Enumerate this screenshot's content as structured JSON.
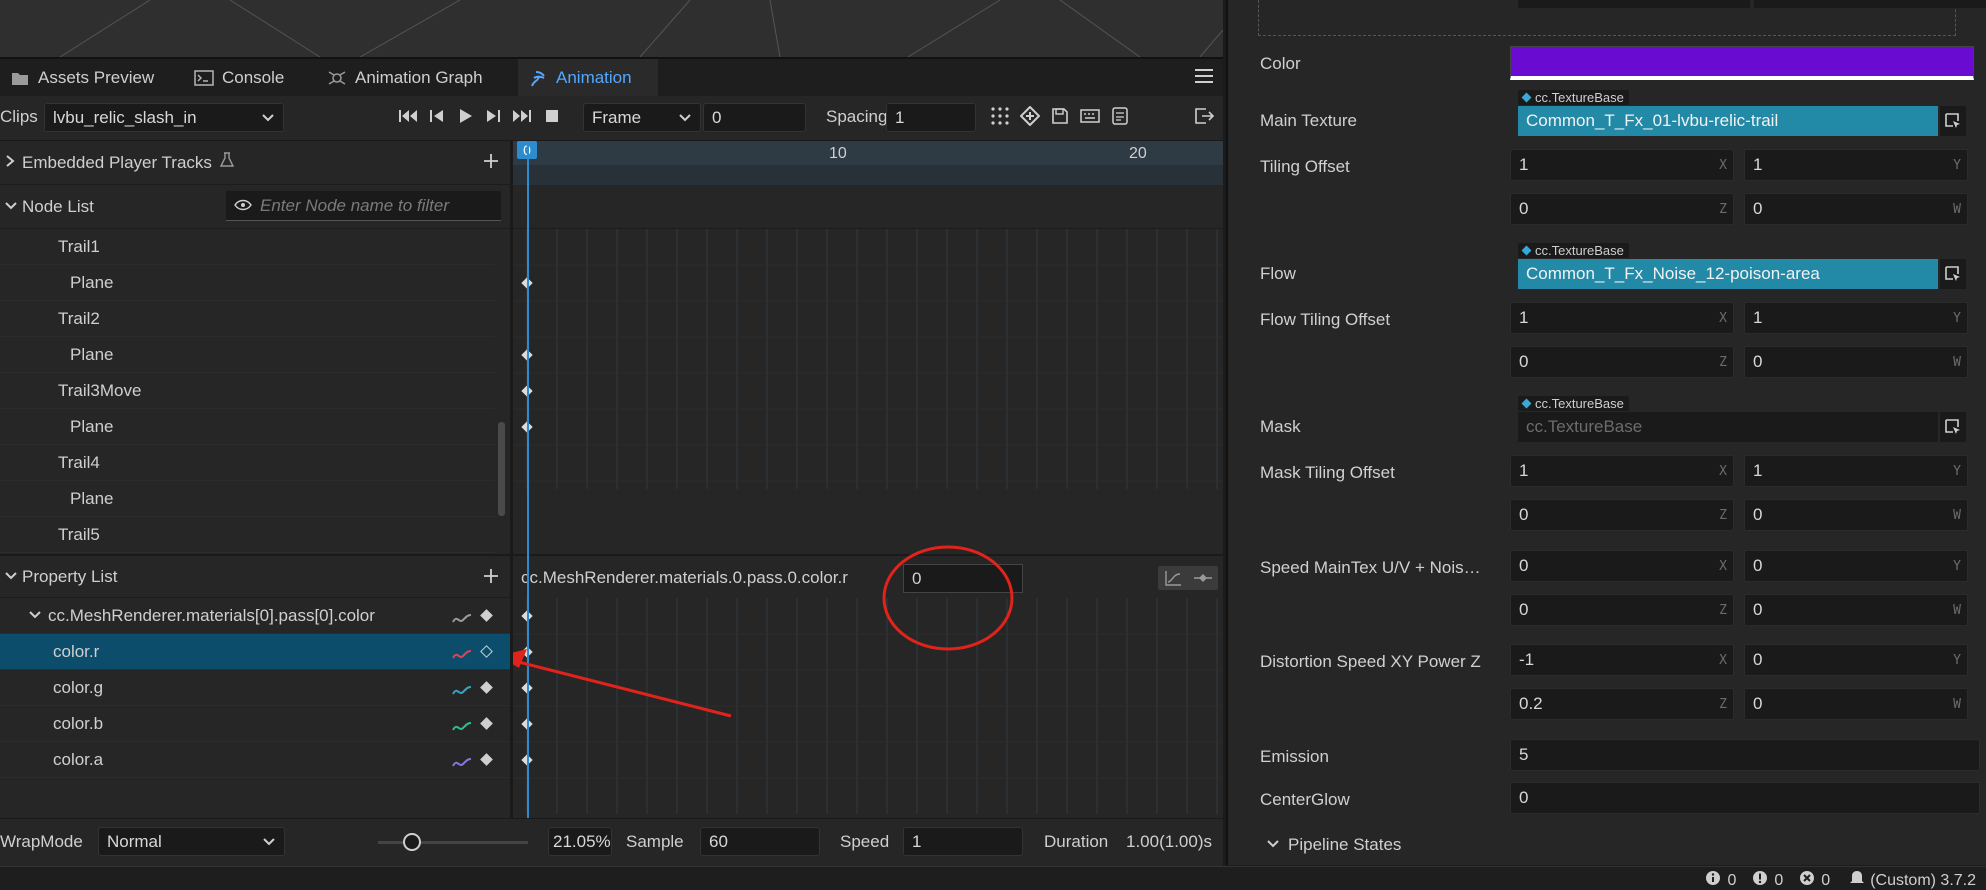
{
  "tabs": [
    {
      "label": "Assets Preview",
      "icon": "folder-icon"
    },
    {
      "label": "Console",
      "icon": "terminal-icon"
    },
    {
      "label": "Animation Graph",
      "icon": "graph-icon"
    },
    {
      "label": "Animation",
      "icon": "animation-icon",
      "active": true
    }
  ],
  "toolbar": {
    "clips_label": "Clips",
    "clip_value": "lvbu_relic_slash_in",
    "frame_mode": "Frame",
    "frame_value": "0",
    "spacing_label": "Spacing",
    "spacing_value": "1"
  },
  "tree": {
    "embedded_label": "Embedded Player Tracks",
    "node_list_label": "Node List",
    "filter_placeholder": "Enter Node name to filter",
    "nodes": [
      {
        "label": "Trail1",
        "indent": 1
      },
      {
        "label": "Plane",
        "indent": 2
      },
      {
        "label": "Trail2",
        "indent": 1
      },
      {
        "label": "Plane",
        "indent": 2
      },
      {
        "label": "Trail3Move",
        "indent": 1
      },
      {
        "label": "Plane",
        "indent": 2
      },
      {
        "label": "Trail4",
        "indent": 1
      },
      {
        "label": "Plane",
        "indent": 2
      },
      {
        "label": "Trail5",
        "indent": 1
      }
    ],
    "property_list_label": "Property List",
    "property_group": "cc.MeshRenderer.materials[0].pass[0].color",
    "properties": [
      {
        "label": "color.r",
        "selected": true,
        "curve_color": "#e0425a"
      },
      {
        "label": "color.g",
        "selected": false,
        "curve_color": "#2fa8c4"
      },
      {
        "label": "color.b",
        "selected": false,
        "curve_color": "#2fbf86"
      },
      {
        "label": "color.a",
        "selected": false,
        "curve_color": "#8a73e6"
      }
    ]
  },
  "timeline": {
    "ruler_labels": [
      "0",
      "10",
      "20"
    ],
    "property_path": "cc.MeshRenderer.materials.0.pass.0.color.r",
    "property_value": "0"
  },
  "bottom": {
    "wrapmode_label": "WrapMode",
    "wrapmode_value": "Normal",
    "zoom_value": "21.05%",
    "sample_label": "Sample",
    "sample_value": "60",
    "speed_label": "Speed",
    "speed_value": "1",
    "duration_label": "Duration",
    "duration_value": "1.00(1.00)s"
  },
  "inspector": {
    "color_label": "Color",
    "color_swatch": "#6a0bd1",
    "main_texture_label": "Main Texture",
    "texture_type": "cc.TextureBase",
    "main_texture_value": "Common_T_Fx_01-lvbu-relic-trail",
    "tiling_offset_label": "Tiling Offset",
    "tiling_offset": [
      "1",
      "1",
      "0",
      "0"
    ],
    "flow_label": "Flow",
    "flow_value": "Common_T_Fx_Noise_12-poison-area",
    "flow_tiling_label": "Flow Tiling Offset",
    "flow_tiling": [
      "1",
      "1",
      "0",
      "0"
    ],
    "mask_label": "Mask",
    "mask_placeholder": "cc.TextureBase",
    "mask_tiling_label": "Mask Tiling Offset",
    "mask_tiling": [
      "1",
      "1",
      "0",
      "0"
    ],
    "speed_maintex_label": "Speed MainTex U/V + Nois…",
    "speed_maintex": [
      "0",
      "0",
      "0",
      "0"
    ],
    "distortion_label": "Distortion Speed XY Power Z",
    "distortion": [
      "-1",
      "0",
      "0.2",
      "0"
    ],
    "emission_label": "Emission",
    "emission_value": "5",
    "centerglow_label": "CenterGlow",
    "centerglow_value": "0",
    "pipeline_label": "Pipeline States",
    "axes": [
      "X",
      "Y",
      "Z",
      "W"
    ]
  },
  "status": {
    "info_count": "0",
    "warn_count": "0",
    "error_count": "0",
    "version": "(Custom) 3.7.2"
  }
}
